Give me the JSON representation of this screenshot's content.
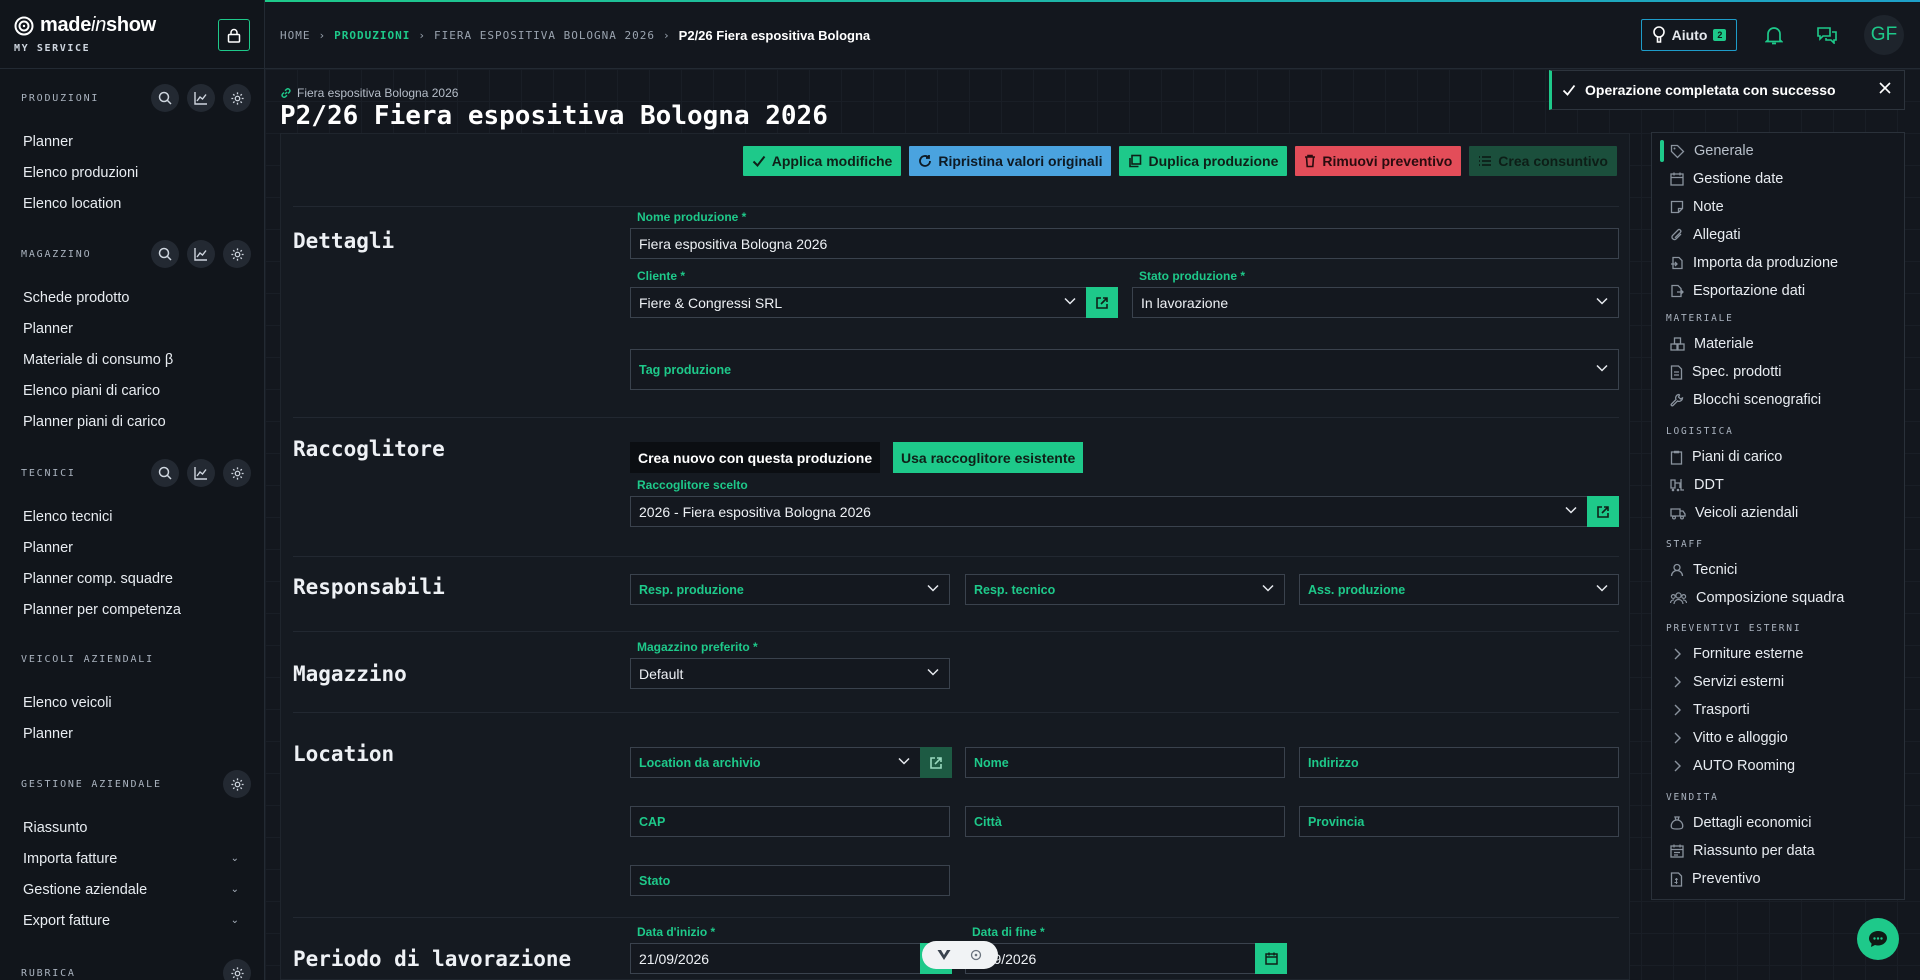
{
  "brand": {
    "name_a": "made",
    "name_b": "in",
    "name_c": "show",
    "subtitle": "MY SERVICE"
  },
  "sidebar": {
    "sections": [
      {
        "title": "PRODUZIONI",
        "items": [
          "Planner",
          "Elenco produzioni",
          "Elenco location"
        ]
      },
      {
        "title": "MAGAZZINO",
        "items": [
          "Schede prodotto",
          "Planner",
          "Materiale di consumo β",
          "Elenco piani di carico",
          "Planner piani di carico"
        ]
      },
      {
        "title": "TECNICI",
        "items": [
          "Elenco tecnici",
          "Planner",
          "Planner comp. squadre",
          "Planner per competenza"
        ]
      },
      {
        "title": "VEICOLI AZIENDALI",
        "items": [
          "Elenco veicoli",
          "Planner"
        ]
      },
      {
        "title": "GESTIONE AZIENDALE",
        "items": [
          "Riassunto",
          "Importa fatture",
          "Gestione aziendale",
          "Export fatture"
        ]
      },
      {
        "title": "RUBRICA",
        "items": []
      }
    ]
  },
  "header": {
    "breadcrumb": [
      "HOME",
      "PRODUZIONI",
      "FIERA ESPOSITIVA BOLOGNA 2026",
      "P2/26 Fiera espositiva Bologna"
    ],
    "help_label": "Aiuto",
    "help_badge": "2",
    "avatar_initials": "GF"
  },
  "page": {
    "supertitle": "Fiera espositiva Bologna 2026",
    "title": "P2/26 Fiera espositiva Bologna 2026"
  },
  "actions": {
    "apply": "Applica modifiche",
    "reset": "Ripristina valori originali",
    "duplicate": "Duplica produzione",
    "remove": "Rimuovi preventivo",
    "create": "Crea consuntivo"
  },
  "colors": {
    "accent": "#1ec98a",
    "blue": "#4aa3df",
    "red": "#e34d59",
    "dark_green": "#1b4f3c"
  },
  "form": {
    "details": {
      "section": "Dettagli",
      "name_label": "Nome produzione *",
      "name_value": "Fiera espositiva Bologna 2026",
      "client_label": "Cliente *",
      "client_value": "Fiere & Congressi SRL",
      "status_label": "Stato produzione *",
      "status_value": "In lavorazione",
      "tag_placeholder": "Tag produzione"
    },
    "collector": {
      "section": "Raccoglitore",
      "toggle_new": "Crea nuovo con questa produzione",
      "toggle_existing": "Usa raccoglitore esistente",
      "chosen_label": "Raccoglitore scelto",
      "chosen_value": "2026 - Fiera espositiva Bologna 2026"
    },
    "responsible": {
      "section": "Responsabili",
      "prod": "Resp. produzione",
      "tech": "Resp. tecnico",
      "assist": "Ass. produzione"
    },
    "warehouse": {
      "section": "Magazzino",
      "label": "Magazzino preferito *",
      "value": "Default"
    },
    "location": {
      "section": "Location",
      "archive": "Location da archivio",
      "name": "Nome",
      "address": "Indirizzo",
      "cap": "CAP",
      "city": "Città",
      "province": "Provincia",
      "state": "Stato"
    },
    "period": {
      "section": "Periodo di lavorazione",
      "start_label": "Data d'inizio *",
      "start_value": "21/09/2026",
      "end_label": "Data di fine *",
      "end_value": "...09/2026"
    }
  },
  "right_nav": {
    "top": [
      "Generale",
      "Gestione date",
      "Note",
      "Allegati",
      "Importa da produzione",
      "Esportazione dati"
    ],
    "materiale_title": "MATERIALE",
    "materiale": [
      "Materiale",
      "Spec. prodotti",
      "Blocchi scenografici"
    ],
    "logistica_title": "LOGISTICA",
    "logistica": [
      "Piani di carico",
      "DDT",
      "Veicoli aziendali"
    ],
    "staff_title": "STAFF",
    "staff": [
      "Tecnici",
      "Composizione squadra"
    ],
    "preventivi_title": "PREVENTIVI ESTERNI",
    "preventivi": [
      "Forniture esterne",
      "Servizi esterni",
      "Trasporti",
      "Vitto e alloggio",
      "AUTO Rooming"
    ],
    "vendita_title": "VENDITA",
    "vendita": [
      "Dettagli economici",
      "Riassunto per data",
      "Preventivo"
    ]
  },
  "toast": {
    "message": "Operazione completata con successo"
  }
}
